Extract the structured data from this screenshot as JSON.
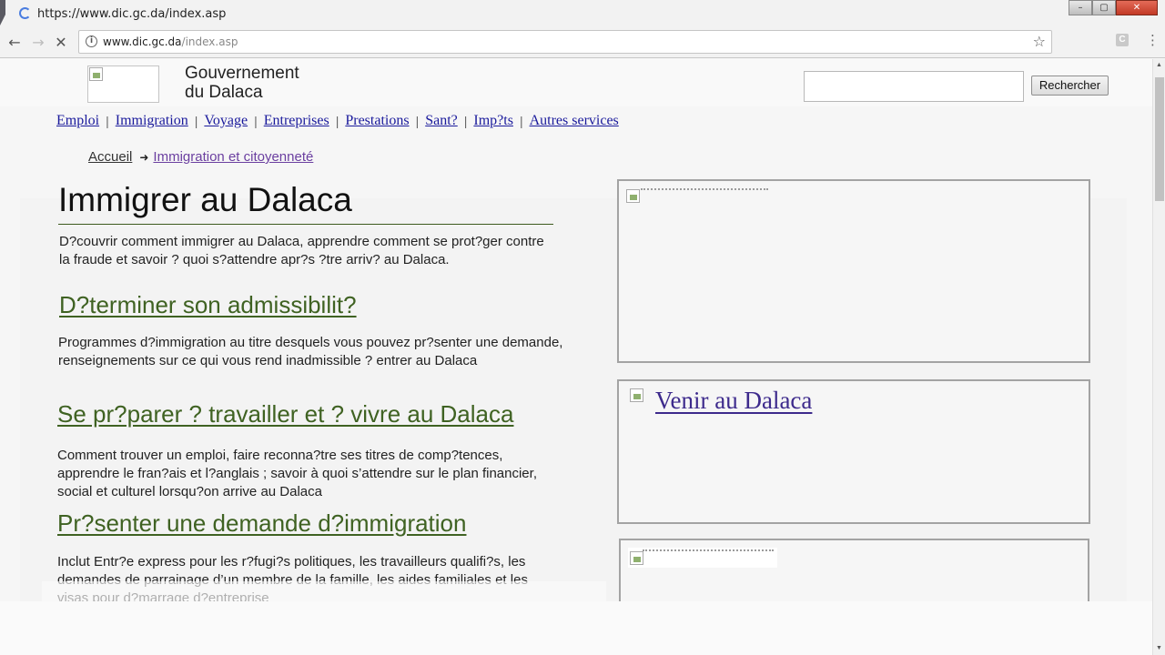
{
  "browser": {
    "tab_title": "https://www.dic.gc.da/index.asp",
    "url_host": "www.dic.gc.da",
    "url_path": "/index.asp",
    "window_buttons": {
      "minimize": "–",
      "maximize": "▢",
      "close": "✕"
    },
    "extension_label": "C",
    "icons": [
      "back-icon",
      "forward-icon",
      "stop-icon",
      "info-icon",
      "star-icon",
      "menu-icon"
    ]
  },
  "header": {
    "gov_title_line1": "Gouvernement",
    "gov_title_line2": "du Dalaca",
    "search_placeholder": "",
    "search_button": "Rechercher"
  },
  "nav": {
    "items": [
      "Emploi",
      "Immigration",
      "Voyage",
      "Entreprises",
      "Prestations",
      "Sant?",
      "Imp?ts",
      "Autres services"
    ]
  },
  "breadcrumb": {
    "home": "Accueil",
    "current": "Immigration et citoyenneté"
  },
  "main": {
    "title": "Immigrer au Dalaca",
    "intro": "D?couvrir comment immigrer au Dalaca, apprendre comment se prot?ger contre la fraude et savoir ? quoi s?attendre apr?s ?tre arriv? au Dalaca.",
    "sections": [
      {
        "heading": "D?terminer son admissibilit?",
        "text": "Programmes d?immigration au titre desquels vous pouvez pr?senter une demande, renseignements sur ce qui vous rend inadmissible ? entrer au Dalaca"
      },
      {
        "heading": "Se pr?parer ? travailler et ? vivre au Dalaca",
        "text": "Comment trouver un emploi, faire reconna?tre ses titres de comp?tences, apprendre le fran?ais et l?anglais ; savoir à quoi s’attendre sur le plan financier, social et culturel lorsqu?on arrive au Dalaca"
      },
      {
        "heading": "Pr?senter une demande d?immigration",
        "text": "Inclut Entr?e express pour les r?fugi?s politiques, les travailleurs qualifi?s, les demandes de parrainage d’un membre de la famille, les aides familiales et les visas pour d?marrage d?entreprise"
      }
    ]
  },
  "sidebar": {
    "box2_link": "Venir au Dalaca"
  },
  "colors": {
    "heading_green": "#3f6222",
    "nav_link": "#1a1a9c",
    "visited_link": "#6b3fa0",
    "accent_spinner": "#4a7de0"
  }
}
